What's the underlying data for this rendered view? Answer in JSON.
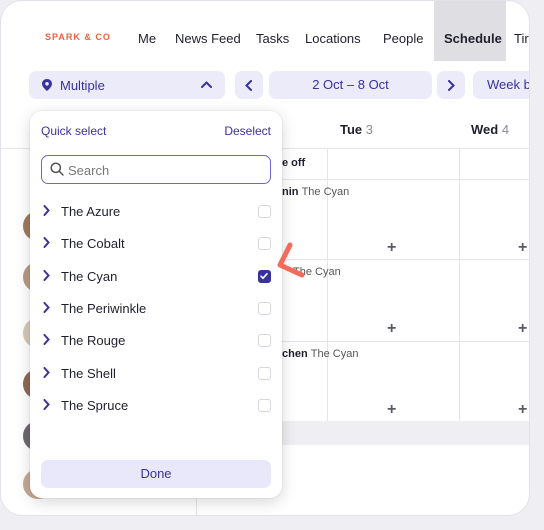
{
  "brand": "SPARK & CO",
  "nav": {
    "items": [
      "Me",
      "News Feed",
      "Tasks",
      "Locations",
      "People",
      "Schedule",
      "Tir"
    ],
    "active": "Schedule"
  },
  "toolbar": {
    "location_label": "Multiple",
    "date_range": "2 Oct – 8 Oct",
    "view_label": "Week b"
  },
  "schedule": {
    "days": [
      {
        "name": "Tue",
        "num": "3"
      },
      {
        "name": "Wed",
        "num": "4"
      }
    ],
    "rows": [
      {
        "label": "e off",
        "sub": ""
      },
      {
        "label": "nin",
        "sub": "The Cyan"
      },
      {
        "label": "",
        "sub": "The Cyan"
      },
      {
        "label": "chen",
        "sub": "The Cyan"
      }
    ],
    "add_symbol": "+"
  },
  "dropdown": {
    "quick_select": "Quick select",
    "deselect": "Deselect",
    "search_placeholder": "Search",
    "items": [
      {
        "name": "The Azure",
        "checked": false
      },
      {
        "name": "The Cobalt",
        "checked": false
      },
      {
        "name": "The Cyan",
        "checked": true
      },
      {
        "name": "The Periwinkle",
        "checked": false
      },
      {
        "name": "The Rouge",
        "checked": false
      },
      {
        "name": "The Shell",
        "checked": false
      },
      {
        "name": "The Spruce",
        "checked": false
      }
    ],
    "done_label": "Done"
  },
  "colors": {
    "accent": "#38329e",
    "accent_light": "#ebebfa",
    "brand": "#e5643e",
    "callout": "#f26b5b"
  }
}
